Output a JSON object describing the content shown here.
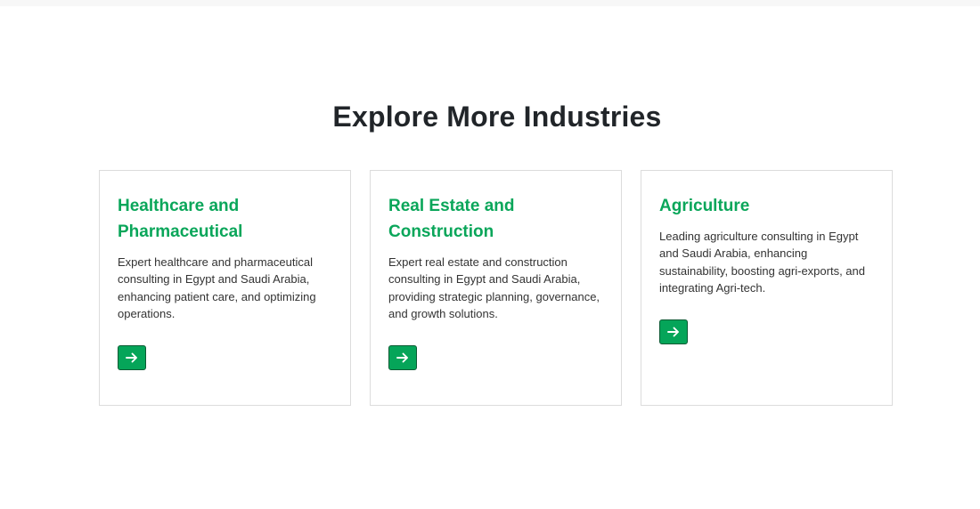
{
  "section": {
    "title": "Explore More Industries"
  },
  "cards": [
    {
      "title": "Healthcare and Pharmaceutical",
      "description": "Expert healthcare and pharmaceutical consulting in Egypt and Saudi Arabia, enhancing patient care, and optimizing operations.",
      "button_icon": "arrow-right-icon"
    },
    {
      "title": "Real Estate and Construction",
      "description": "Expert real estate and construction consulting in Egypt and Saudi Arabia, providing strategic planning, governance, and growth solutions.",
      "button_icon": "arrow-right-icon"
    },
    {
      "title": "Agriculture",
      "description": "Leading agriculture consulting in Egypt and Saudi Arabia, enhancing sustainability, boosting agri-exports, and integrating Agri-tech.",
      "button_icon": "arrow-right-icon"
    }
  ],
  "colors": {
    "accent": "#0aa65a",
    "button": "#05a559",
    "heading": "#212529"
  }
}
